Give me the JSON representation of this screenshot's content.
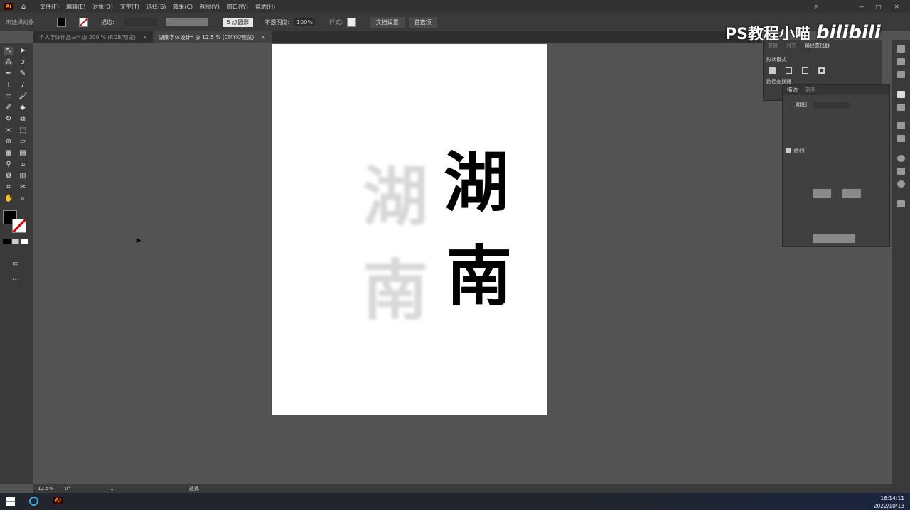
{
  "menubar": {
    "app_icon": "Ai",
    "items": [
      "文件(F)",
      "编辑(E)",
      "对象(O)",
      "文字(T)",
      "选择(S)",
      "效果(C)",
      "视图(V)",
      "窗口(W)",
      "帮助(H)"
    ]
  },
  "control": {
    "selection": "未选择对象",
    "stroke_label": "描边:",
    "brush": "5 点圆形",
    "opacity_label": "不透明度:",
    "opacity": "100%",
    "style_label": "样式:",
    "doc_setup": "文档设置",
    "prefs": "首选项"
  },
  "tabs": [
    {
      "label": "个人字体作品.ai* @ 200 % (RGB/预览)",
      "close": "×"
    },
    {
      "label": "湖南字体设计* @ 12.5 % (CMYK/预览)",
      "close": "×"
    }
  ],
  "artboard": {
    "char1": "湖",
    "char2": "南"
  },
  "watermark": {
    "text": "PS教程小喵",
    "brand": "bilibili"
  },
  "pathfinder": {
    "tabs": [
      "变换",
      "对齐",
      "路径查找器"
    ],
    "shape_modes": "形状模式",
    "pathfinders": "路径查找器"
  },
  "stroke_panel": {
    "tabs": [
      "描边",
      "渐变"
    ],
    "weight_label": "粗细:",
    "dashed": "虚线"
  },
  "status": {
    "zoom": "12.5%",
    "rotate": "0°",
    "artboard": "1",
    "tool": "选择"
  },
  "taskbar": {
    "time": "16:14:11",
    "date": "2022/10/13",
    "ai": "Ai"
  }
}
